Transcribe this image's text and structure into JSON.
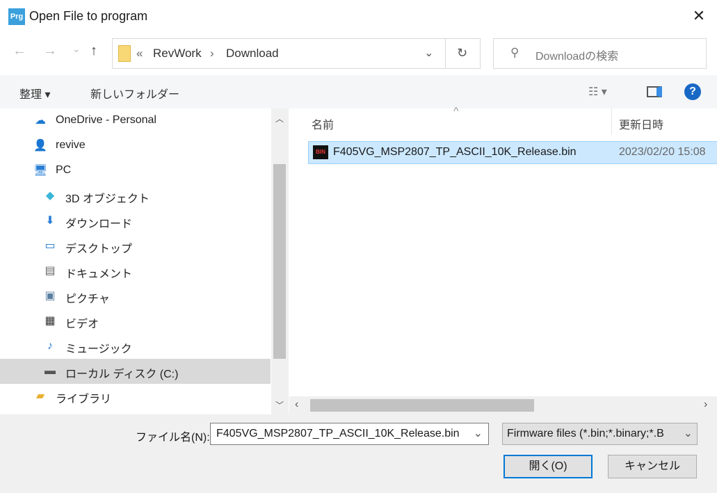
{
  "window": {
    "title": "Open File to program",
    "icon_text": "Prg"
  },
  "nav": {
    "back": "←",
    "forward": "→",
    "recent": "⌄",
    "up": "↑",
    "breadcrumb": [
      "«",
      "RevWork",
      "›",
      "Download"
    ],
    "search_placeholder": "Downloadの検索"
  },
  "toolbar": {
    "organize": "整理 ▾",
    "new_folder": "新しいフォルダー"
  },
  "sidebar": {
    "items": [
      {
        "label": "OneDrive - Personal",
        "icon": "cloud-icon"
      },
      {
        "label": "revive",
        "icon": "user-icon"
      },
      {
        "label": "PC",
        "icon": "computer-icon"
      },
      {
        "label": "3D オブジェクト",
        "icon": "cube-icon"
      },
      {
        "label": "ダウンロード",
        "icon": "download-icon"
      },
      {
        "label": "デスクトップ",
        "icon": "desktop-icon"
      },
      {
        "label": "ドキュメント",
        "icon": "document-icon"
      },
      {
        "label": "ピクチャ",
        "icon": "picture-icon"
      },
      {
        "label": "ビデオ",
        "icon": "video-icon"
      },
      {
        "label": "ミュージック",
        "icon": "music-icon"
      },
      {
        "label": "ローカル ディスク (C:)",
        "icon": "drive-icon",
        "selected": true
      },
      {
        "label": "ライブラリ",
        "icon": "library-icon"
      }
    ]
  },
  "files": {
    "columns": [
      "名前",
      "更新日時"
    ],
    "rows": [
      {
        "name": "F405VG_MSP2807_TP_ASCII_10K_Release.bin",
        "modified": "2023/02/20 15:08",
        "icon_text": "BIN"
      }
    ]
  },
  "bottom": {
    "filename_label": "ファイル名(N):",
    "filename_value": "F405VG_MSP2807_TP_ASCII_10K_Release.bin",
    "filetype": "Firmware files (*.bin;*.binary;*.B",
    "open": "開く(O)",
    "cancel": "キャンセル"
  },
  "colors": {
    "accent": "#0078d7",
    "selection": "#cce8ff"
  }
}
